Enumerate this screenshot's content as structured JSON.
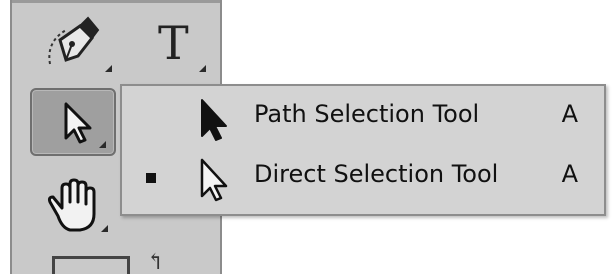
{
  "toolbar": {
    "tools": [
      {
        "name": "pen-tool",
        "icon": "pen-icon"
      },
      {
        "name": "type-tool",
        "icon": "type-icon",
        "glyph": "T"
      },
      {
        "name": "path-selection-tool",
        "icon": "arrow-pointer-icon"
      },
      {
        "name": "hand-tool",
        "icon": "hand-icon"
      }
    ]
  },
  "flyout": {
    "items": [
      {
        "label": "Path Selection Tool",
        "shortcut": "A",
        "icon": "filled-arrow-icon",
        "selected": false
      },
      {
        "label": "Direct Selection Tool",
        "shortcut": "A",
        "icon": "hollow-arrow-icon",
        "selected": true
      }
    ]
  },
  "colors": {
    "toolbar_bg": "#c9c9c9",
    "flyout_bg": "#d3d3d3",
    "active_tool_bg": "#9f9f9f"
  }
}
